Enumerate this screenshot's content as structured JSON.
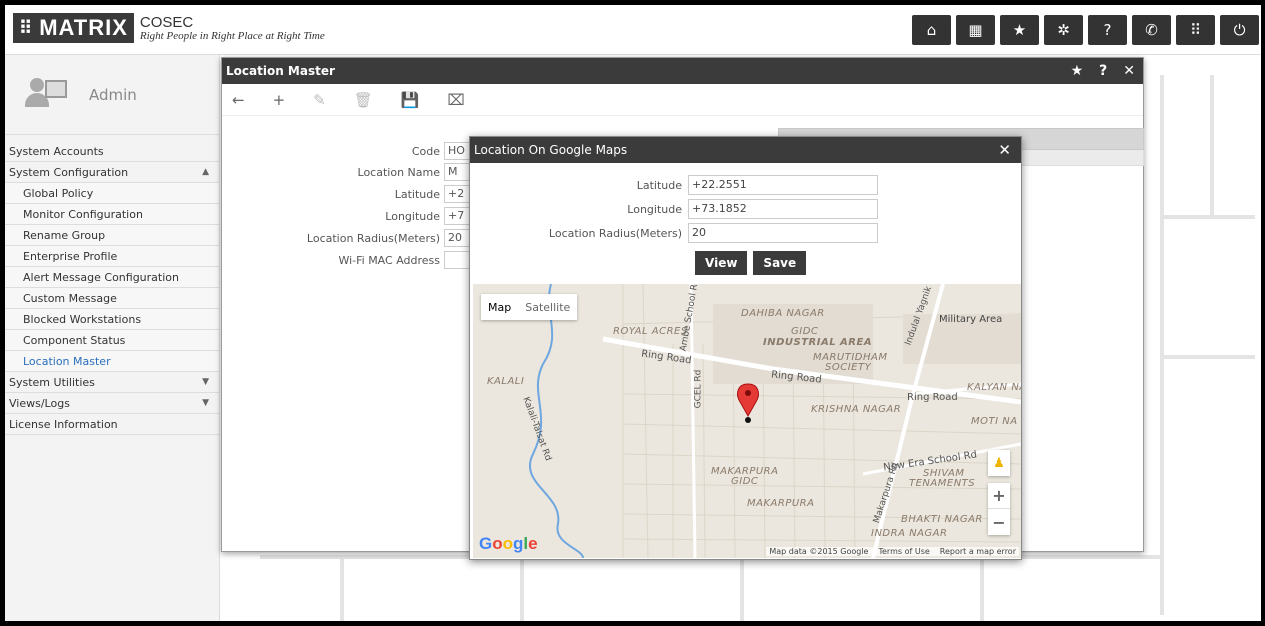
{
  "header": {
    "logo_text": "MATRIX",
    "app_name": "COSEC",
    "tagline": "Right People in Right Place at Right Time",
    "icons": [
      "home-icon",
      "grid-icon",
      "star-icon",
      "gear-icon",
      "help-icon",
      "phone-icon",
      "apps-icon",
      "power-icon"
    ],
    "icon_glyphs": [
      "⌂",
      "▦",
      "★",
      "✲",
      "?",
      "✆",
      "⠿",
      "⏻"
    ]
  },
  "sidebar": {
    "user": "Admin",
    "items": [
      {
        "label": "System Accounts",
        "level": 0
      },
      {
        "label": "System Configuration",
        "level": 0,
        "arrow": "▲"
      },
      {
        "label": "Global Policy",
        "level": 1
      },
      {
        "label": "Monitor Configuration",
        "level": 1
      },
      {
        "label": "Rename Group",
        "level": 1
      },
      {
        "label": "Enterprise Profile",
        "level": 1
      },
      {
        "label": "Alert Message Configuration",
        "level": 1
      },
      {
        "label": "Custom Message",
        "level": 1
      },
      {
        "label": "Blocked Workstations",
        "level": 1
      },
      {
        "label": "Component Status",
        "level": 1
      },
      {
        "label": "Location Master",
        "level": 1,
        "active": true
      },
      {
        "label": "System Utilities",
        "level": 0,
        "arrow": "▼"
      },
      {
        "label": "Views/Logs",
        "level": 0,
        "arrow": "▼"
      },
      {
        "label": "License Information",
        "level": 0
      }
    ]
  },
  "window": {
    "title": "Location Master",
    "controls": [
      "★",
      "?",
      "✕"
    ],
    "toolbar": [
      "←",
      "+",
      "✎",
      "🗑",
      "💾",
      "⌧"
    ],
    "fields": [
      {
        "label": "Code",
        "value": "HO"
      },
      {
        "label": "Location Name",
        "value": "M"
      },
      {
        "label": "Latitude",
        "value": "+2"
      },
      {
        "label": "Longitude",
        "value": "+7"
      },
      {
        "label": "Location Radius(Meters)",
        "value": "20"
      },
      {
        "label": "Wi-Fi MAC Address",
        "value": ""
      }
    ]
  },
  "dialog": {
    "title": "Location On Google Maps",
    "close": "✕",
    "latitude_label": "Latitude",
    "latitude_value": "+22.2551",
    "longitude_label": "Longitude",
    "longitude_value": "+73.1852",
    "radius_label": "Location Radius(Meters)",
    "radius_value": "20",
    "view_btn": "View",
    "save_btn": "Save"
  },
  "map": {
    "map_tab": "Map",
    "satellite_tab": "Satellite",
    "labels": {
      "dahiba": "DAHIBA NAGAR",
      "royal": "ROYAL ACRES",
      "gidc": "GIDC",
      "industrial": "INDUSTRIAL AREA",
      "marutidham": "MARUTIDHAM",
      "society": "SOCIETY",
      "military": "Military Area",
      "ring1": "Ring Road",
      "ring2": "Ring Road",
      "ring3": "Ring Road",
      "kalali": "KALALI",
      "kalyan": "KALYAN NA",
      "krishna": "KRISHNA NAGAR",
      "moti": "MOTI NA",
      "gcel": "GCEL Rd",
      "ambe": "Ambe School Rd",
      "indulal": "Indulal Yagnik Rd",
      "talsat": "Kalali-Talsat Rd",
      "newera": "New Era School Rd",
      "shivam": "SHIVAM",
      "tenaments": "TENAMENTS",
      "makarpura_gidc": "MAKARPURA",
      "gidc2": "GIDC",
      "makarpura": "MAKARPURA",
      "makarpura_rd": "Makarpura Rd",
      "bhakti": "BHAKTI NAGAR",
      "indra": "INDRA NAGAR"
    },
    "google": "Google",
    "attribution": [
      "Map data ©2015 Google",
      "Terms of Use",
      "Report a map error"
    ],
    "zoom_in": "+",
    "zoom_out": "−"
  },
  "colors": {
    "dark_bar": "#3b3b3b",
    "active_link": "#2a6ebb",
    "pin": "#e53935"
  }
}
